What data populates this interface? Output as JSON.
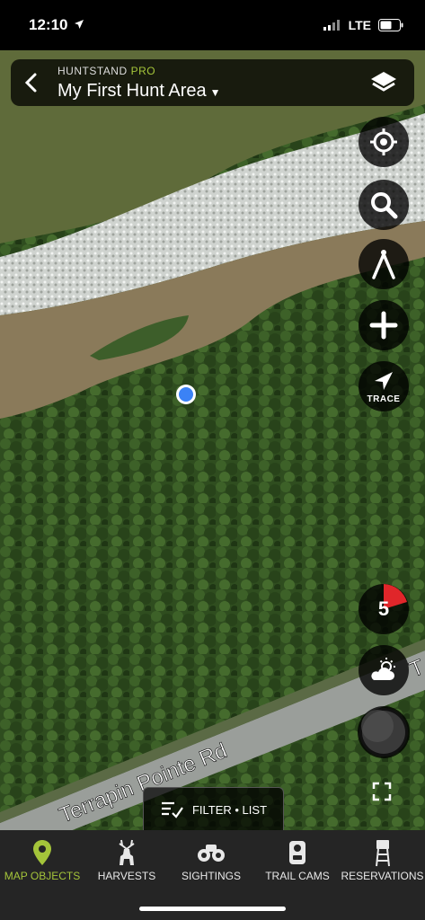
{
  "status_bar": {
    "time": "12:10",
    "network": "LTE"
  },
  "header": {
    "brand": "HUNTSTAND",
    "brand_tier": "PRO",
    "title": "My First Hunt Area"
  },
  "map": {
    "road_label": "Terrapin Pointe Rd",
    "road_label_partial": "T"
  },
  "controls": {
    "trace_label": "TRACE",
    "wind_speed": "5"
  },
  "filter": {
    "label": "FILTER • LIST"
  },
  "tabs": [
    {
      "label": "MAP OBJECTS",
      "icon": "map-pin-icon",
      "active": true
    },
    {
      "label": "HARVESTS",
      "icon": "deer-icon"
    },
    {
      "label": "SIGHTINGS",
      "icon": "binoculars-icon"
    },
    {
      "label": "TRAIL CAMS",
      "icon": "trail-cam-icon"
    },
    {
      "label": "RESERVATIONS",
      "icon": "tree-stand-icon"
    }
  ],
  "colors": {
    "accent": "#a4c43a",
    "wind_red": "#e0262a",
    "location_dot": "#3b82f6"
  }
}
